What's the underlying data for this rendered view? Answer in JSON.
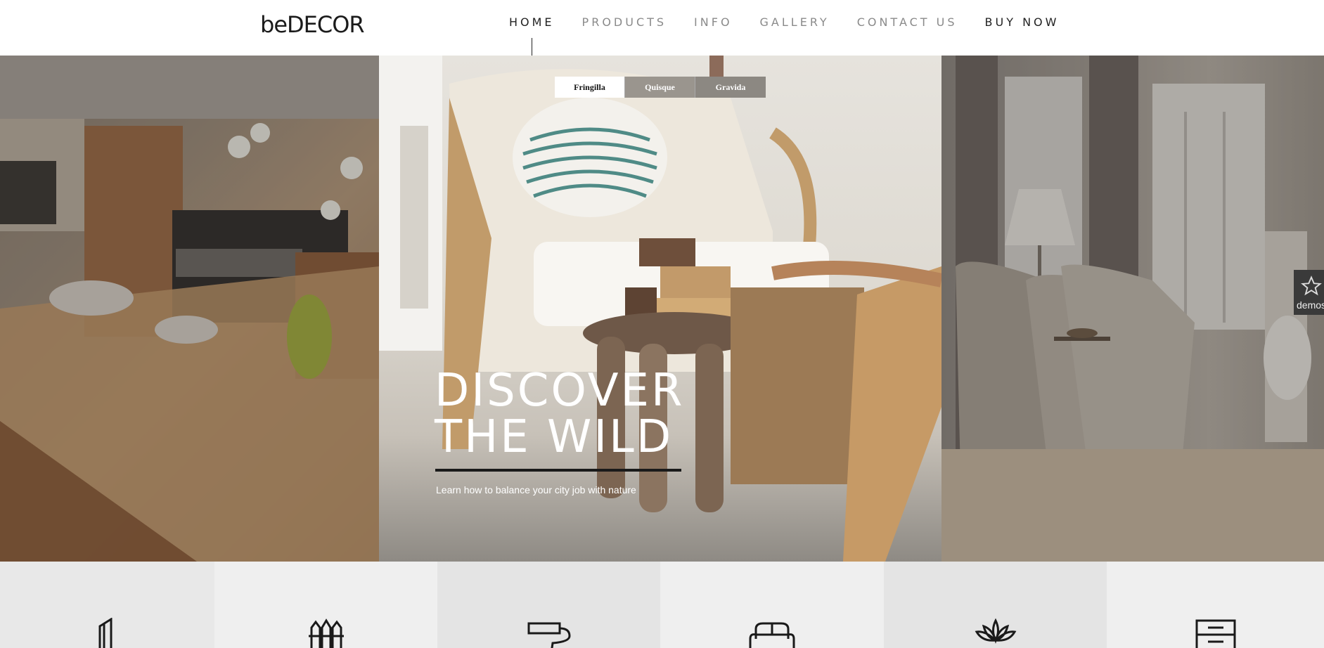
{
  "brand": {
    "logo_prefix": "be",
    "logo_main": "DECOR"
  },
  "nav": {
    "items": [
      {
        "label": "HOME",
        "active": true
      },
      {
        "label": "PRODUCTS",
        "active": false
      },
      {
        "label": "INFO",
        "active": false
      },
      {
        "label": "GALLERY",
        "active": false
      },
      {
        "label": "CONTACT US",
        "active": false
      },
      {
        "label": "BUY NOW",
        "active": false
      }
    ]
  },
  "slider": {
    "tabs": [
      {
        "label": "Fringilla",
        "active": true
      },
      {
        "label": "Quisque",
        "active": false
      },
      {
        "label": "Gravida",
        "active": false
      }
    ],
    "headline_line1": "DISCOVER",
    "headline_line2": "THE WILD",
    "subtitle": "Learn how to balance your city job with nature"
  },
  "demo_tab": {
    "label": "demos",
    "icon": "star-icon"
  },
  "categories": [
    {
      "icon": "wall-icon",
      "bg": "#e8e8e8"
    },
    {
      "icon": "fence-icon",
      "bg": "#efefef"
    },
    {
      "icon": "paint-roller-icon",
      "bg": "#e4e4e4"
    },
    {
      "icon": "sofa-icon",
      "bg": "#efefef"
    },
    {
      "icon": "lotus-icon",
      "bg": "#e4e4e4"
    },
    {
      "icon": "dresser-icon",
      "bg": "#efefef"
    }
  ],
  "colors": {
    "accent": "#1a1a1a",
    "nav_inactive": "#8a8a8a",
    "tab_bg": "#9a958e"
  }
}
